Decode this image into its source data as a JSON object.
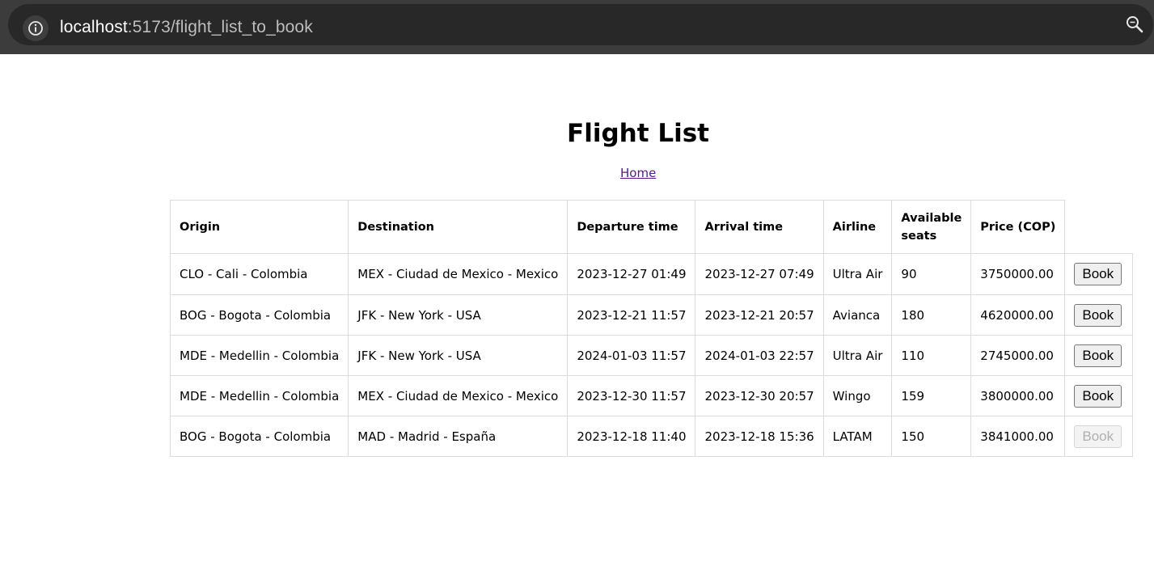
{
  "browser": {
    "url_host": "localhost",
    "url_path": ":5173/flight_list_to_book"
  },
  "page": {
    "title": "Flight List",
    "home_link": "Home"
  },
  "table": {
    "headers": {
      "origin": "Origin",
      "destination": "Destination",
      "departure": "Departure time",
      "arrival": "Arrival time",
      "airline": "Airline",
      "seats_line1": "Available",
      "seats_line2": "seats",
      "price": "Price (COP)"
    },
    "rows": [
      {
        "origin": "CLO - Cali - Colombia",
        "destination": "MEX - Ciudad de Mexico - Mexico",
        "departure": "2023-12-27 01:49",
        "arrival": "2023-12-27 07:49",
        "airline": "Ultra Air",
        "seats": "90",
        "price": "3750000.00",
        "book_label": "Book"
      },
      {
        "origin": "BOG - Bogota - Colombia",
        "destination": "JFK - New York - USA",
        "departure": "2023-12-21 11:57",
        "arrival": "2023-12-21 20:57",
        "airline": "Avianca",
        "seats": "180",
        "price": "4620000.00",
        "book_label": "Book"
      },
      {
        "origin": "MDE - Medellin - Colombia",
        "destination": "JFK - New York - USA",
        "departure": "2024-01-03 11:57",
        "arrival": "2024-01-03 22:57",
        "airline": "Ultra Air",
        "seats": "110",
        "price": "2745000.00",
        "book_label": "Book"
      },
      {
        "origin": "MDE - Medellin - Colombia",
        "destination": "MEX - Ciudad de Mexico - Mexico",
        "departure": "2023-12-30 11:57",
        "arrival": "2023-12-30 20:57",
        "airline": "Wingo",
        "seats": "159",
        "price": "3800000.00",
        "book_label": "Book"
      },
      {
        "origin": "BOG - Bogota - Colombia",
        "destination": "MAD - Madrid - España",
        "departure": "2023-12-18 11:40",
        "arrival": "2023-12-18 15:36",
        "airline": "LATAM",
        "seats": "150",
        "price": "3841000.00",
        "book_label": "Book",
        "book_disabled": true
      }
    ]
  },
  "icons": {
    "info": "info-icon",
    "zoom": "zoom-icon"
  }
}
